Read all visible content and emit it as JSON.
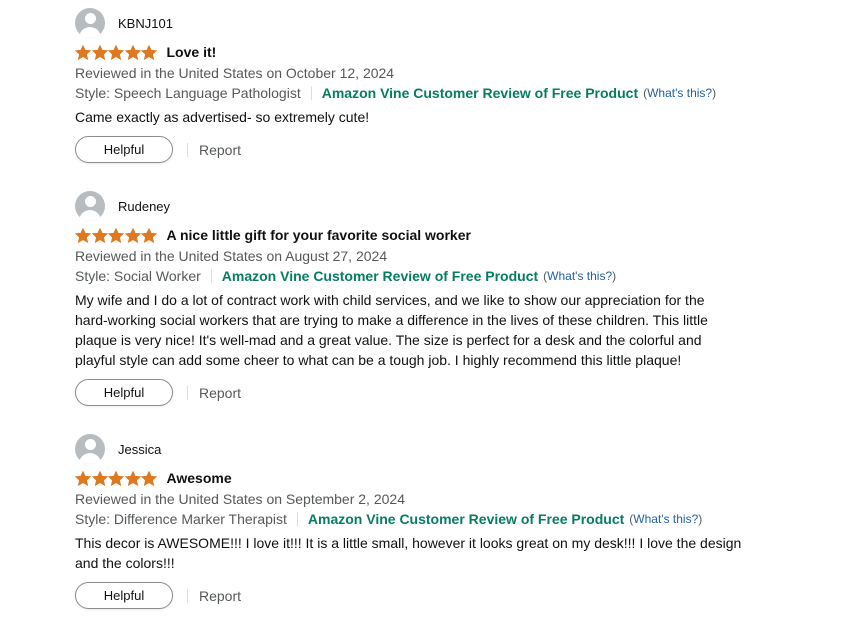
{
  "colors": {
    "star": "#de7921",
    "vine_green": "#067d62",
    "link_blue": "#2162a1",
    "muted_text": "#565959"
  },
  "icons": {
    "avatar": "default-user-avatar-icon",
    "star": "star-filled-icon"
  },
  "reviews": [
    {
      "username": "KBNJ101",
      "rating": 5,
      "rating_max": 5,
      "title": "Love it!",
      "date": "Reviewed in the United States on October 12, 2024",
      "style": "Style: Speech Language Pathologist",
      "vine_label": "Amazon Vine Customer Review of Free Product",
      "whats_open": "(",
      "whats_link": "What's this?",
      "whats_close": ")",
      "body": "Came exactly as advertised- so extremely cute!",
      "helpful_label": "Helpful",
      "report_label": "Report"
    },
    {
      "username": "Rudeney",
      "rating": 5,
      "rating_max": 5,
      "title": "A nice little gift for your favorite social worker",
      "date": "Reviewed in the United States on August 27, 2024",
      "style": "Style: Social Worker",
      "vine_label": "Amazon Vine Customer Review of Free Product",
      "whats_open": "(",
      "whats_link": "What's this?",
      "whats_close": ")",
      "body_lines": [
        "My wife and I do a lot of contract work with child services, and we like to show our appreciation for the",
        "hard-working social workers that are trying to make a difference in the lives of these children. This little",
        "plaque is very nice! It's well-mad and a great value. The size is perfect for a desk and the colorful and",
        "playful style can add some cheer to what can be a tough job. I highly recommend this little plaque!"
      ],
      "helpful_label": "Helpful",
      "report_label": "Report"
    },
    {
      "username": "Jessica",
      "rating": 5,
      "rating_max": 5,
      "title": "Awesome",
      "date": "Reviewed in the United States on September 2, 2024",
      "style": "Style: Difference Marker Therapist",
      "vine_label": "Amazon Vine Customer Review of Free Product",
      "whats_open": "(",
      "whats_link": "What's this?",
      "whats_close": ")",
      "body_lines": [
        "This decor is AWESOME!!! I love it!!! It is a little small, however it looks great on my desk!!! I love the design",
        "and the colors!!!"
      ],
      "helpful_label": "Helpful",
      "report_label": "Report"
    }
  ]
}
